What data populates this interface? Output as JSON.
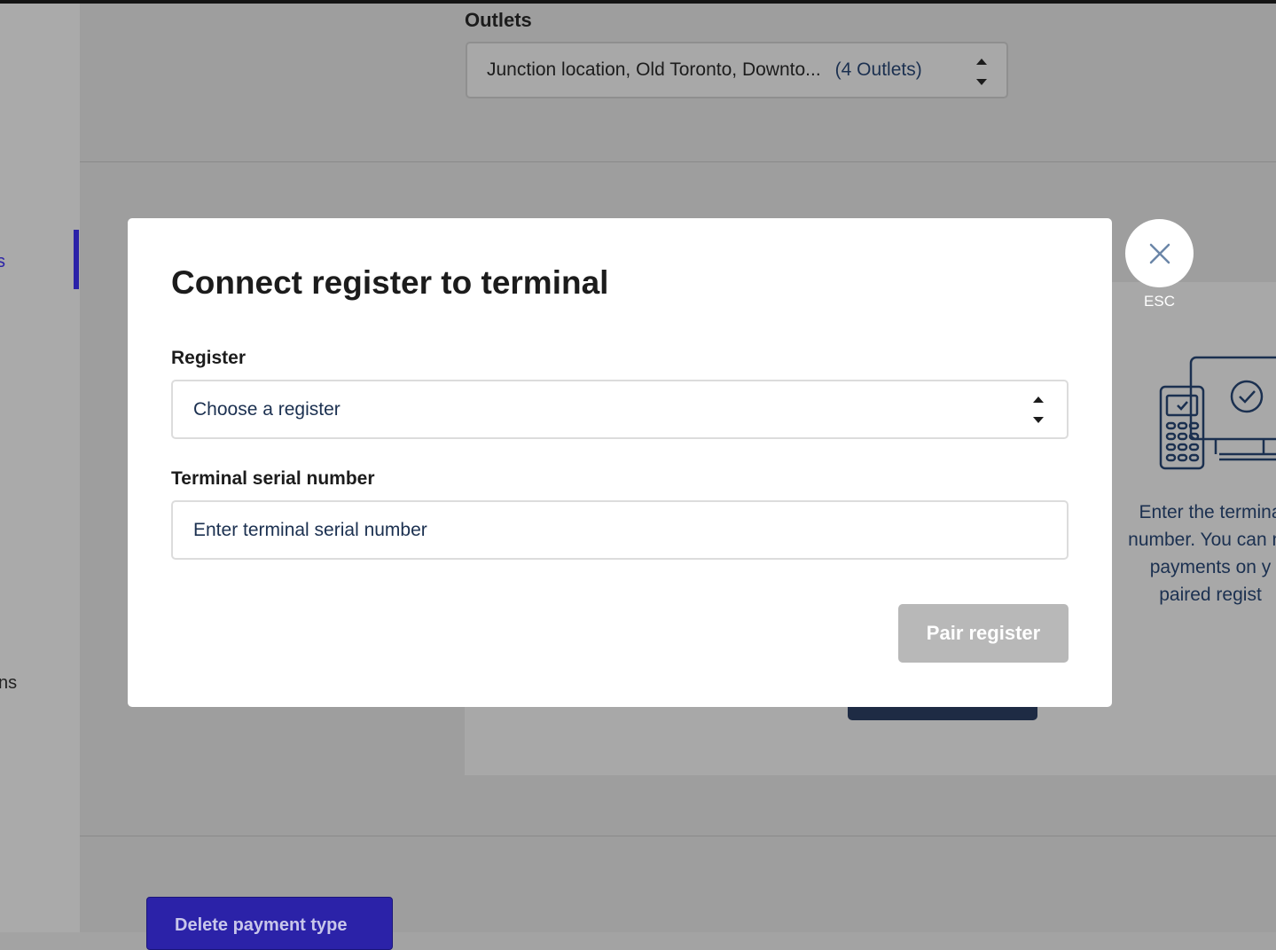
{
  "background": {
    "sidebar": {
      "items": [
        {
          "label": "s"
        },
        {
          "label": "ns"
        }
      ]
    },
    "outlets": {
      "label": "Outlets",
      "selected_value": "Junction location, Old Toronto, Downto...",
      "count_label": "(4 Outlets)"
    },
    "info_panel": {
      "lines": [
        "Enter the termina",
        "number. You can no",
        "payments on y",
        "paired regist"
      ]
    },
    "delete_button_label": "Delete payment type"
  },
  "modal": {
    "title": "Connect register to terminal",
    "register": {
      "label": "Register",
      "placeholder": "Choose a register"
    },
    "serial": {
      "label": "Terminal serial number",
      "placeholder": "Enter terminal serial number"
    },
    "submit_label": "Pair register",
    "close_hint": "ESC"
  },
  "colors": {
    "overlay": "#9e9e9e",
    "accent": "#2b22a8",
    "text_link": "#1b3050",
    "disabled_button": "#b8b8b8"
  },
  "icons": {
    "close": "close-icon",
    "stepper": "up-down-chevron-icon",
    "illustration": "terminal-register-illustration-icon"
  }
}
